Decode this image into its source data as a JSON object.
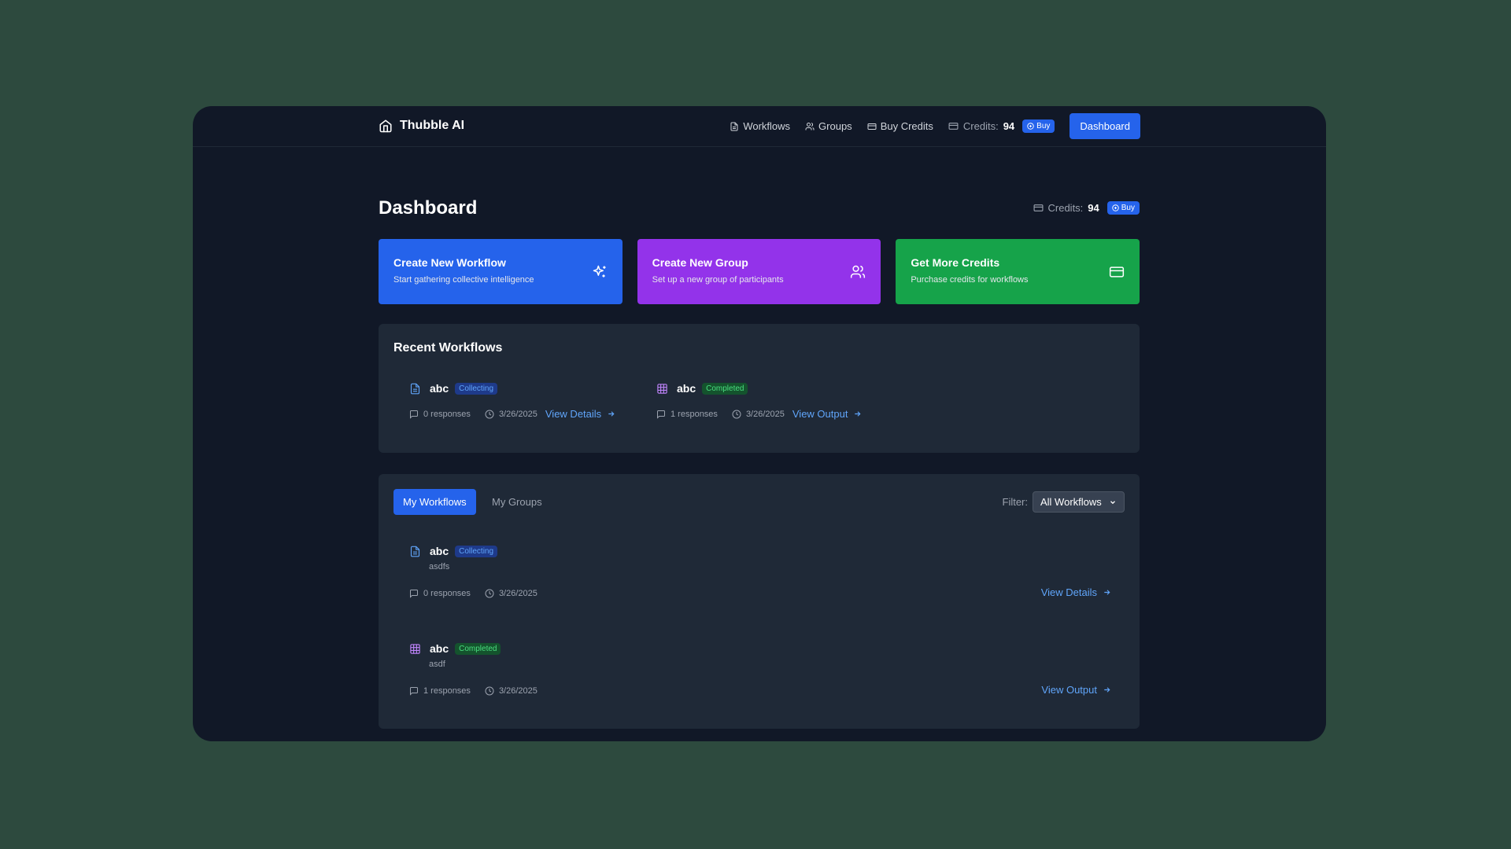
{
  "app": {
    "name": "Thubble AI"
  },
  "nav": {
    "items": [
      {
        "label": "Workflows",
        "icon": "file-icon"
      },
      {
        "label": "Groups",
        "icon": "users-icon"
      },
      {
        "label": "Buy Credits",
        "icon": "credit-card-icon"
      }
    ],
    "credits_label": "Credits:",
    "credits_value": "94",
    "buy_label": "Buy",
    "dashboard_label": "Dashboard"
  },
  "page": {
    "title": "Dashboard",
    "credits_label": "Credits:",
    "credits_value": "94",
    "buy_label": "Buy"
  },
  "cards": [
    {
      "title": "Create New Workflow",
      "subtitle": "Start gathering collective intelligence",
      "icon": "sparkles-icon",
      "color": "#2563eb"
    },
    {
      "title": "Create New Group",
      "subtitle": "Set up a new group of participants",
      "icon": "users-icon",
      "color": "#9333ea"
    },
    {
      "title": "Get More Credits",
      "subtitle": "Purchase credits for workflows",
      "icon": "credit-card-icon",
      "color": "#16a34a"
    }
  ],
  "recent": {
    "title": "Recent Workflows",
    "items": [
      {
        "name": "abc",
        "status": "Collecting",
        "responses": "0 responses",
        "date": "3/26/2025",
        "action": "View Details",
        "icon": "file-icon"
      },
      {
        "name": "abc",
        "status": "Completed",
        "responses": "1 responses",
        "date": "3/26/2025",
        "action": "View Output",
        "icon": "table-icon"
      }
    ]
  },
  "tabs": {
    "active": "My Workflows",
    "inactive": "My Groups"
  },
  "filter": {
    "label": "Filter:",
    "value": "All Workflows"
  },
  "workflows": [
    {
      "name": "abc",
      "status": "Collecting",
      "description": "asdfs",
      "responses": "0 responses",
      "date": "3/26/2025",
      "action": "View Details",
      "icon": "file-icon"
    },
    {
      "name": "abc",
      "status": "Completed",
      "description": "asdf",
      "responses": "1 responses",
      "date": "3/26/2025",
      "action": "View Output",
      "icon": "table-icon"
    }
  ],
  "colors": {
    "background": "#2d4a3e",
    "window": "#111827",
    "panel": "#1f2937",
    "accent": "#2563eb",
    "link": "#60a5fa"
  }
}
